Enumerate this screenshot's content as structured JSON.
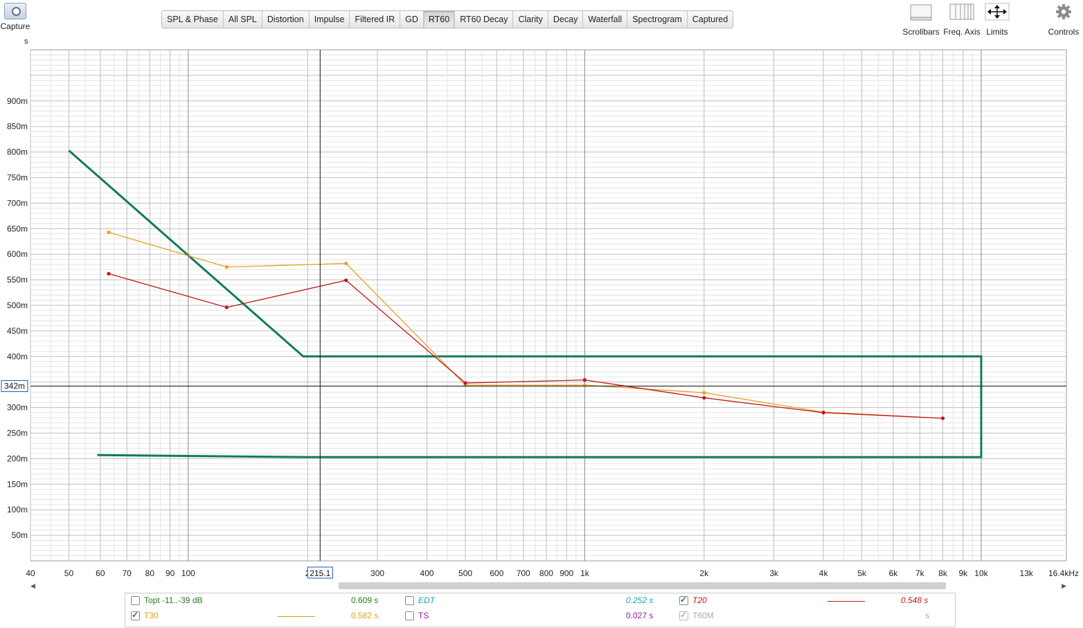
{
  "toolbar": {
    "capture_label": "Capture",
    "tabs": [
      "SPL & Phase",
      "All SPL",
      "Distortion",
      "Impulse",
      "Filtered IR",
      "GD",
      "RT60",
      "RT60 Decay",
      "Clarity",
      "Decay",
      "Waterfall",
      "Spectrogram",
      "Captured"
    ],
    "active_tab": "RT60",
    "scrollbars_label": "Scrollbars",
    "freq_axis_label": "Freq. Axis",
    "limits_label": "Limits",
    "controls_label": "Controls"
  },
  "colors": {
    "t30": "#e8a020",
    "t20": "#c01818",
    "target": "#117a58",
    "grid_major": "#bdbdbd",
    "grid_minor": "#e4e4e4",
    "cursor_box": "#1c4fc0"
  },
  "chart_data": {
    "type": "line",
    "xscale": "log",
    "xlim": [
      40,
      16400
    ],
    "ylim": [
      0,
      1
    ],
    "y_unit": "s",
    "x_ticks": [
      {
        "v": 40,
        "t": "40"
      },
      {
        "v": 50,
        "t": "50"
      },
      {
        "v": 60,
        "t": "60"
      },
      {
        "v": 70,
        "t": "70"
      },
      {
        "v": 80,
        "t": "80"
      },
      {
        "v": 90,
        "t": "90"
      },
      {
        "v": 100,
        "t": "100"
      },
      {
        "v": 200,
        "t": "2"
      },
      {
        "v": 300,
        "t": "300"
      },
      {
        "v": 400,
        "t": "400"
      },
      {
        "v": 500,
        "t": "500"
      },
      {
        "v": 600,
        "t": "600"
      },
      {
        "v": 700,
        "t": "700"
      },
      {
        "v": 800,
        "t": "800"
      },
      {
        "v": 900,
        "t": "900"
      },
      {
        "v": 1000,
        "t": "1k"
      },
      {
        "v": 2000,
        "t": "2k"
      },
      {
        "v": 3000,
        "t": "3k"
      },
      {
        "v": 4000,
        "t": "4k"
      },
      {
        "v": 5000,
        "t": "5k"
      },
      {
        "v": 6000,
        "t": "6k"
      },
      {
        "v": 7000,
        "t": "7k"
      },
      {
        "v": 8000,
        "t": "8k"
      },
      {
        "v": 9000,
        "t": "9k"
      },
      {
        "v": 10000,
        "t": "10k"
      },
      {
        "v": 13000,
        "t": "13k"
      },
      {
        "v": 16400,
        "t": "16.4kHz"
      }
    ],
    "y_ticks": [
      {
        "v": 0.05,
        "t": "50m"
      },
      {
        "v": 0.1,
        "t": "100m"
      },
      {
        "v": 0.15,
        "t": "150m"
      },
      {
        "v": 0.2,
        "t": "200m"
      },
      {
        "v": 0.25,
        "t": "250m"
      },
      {
        "v": 0.3,
        "t": "300m"
      },
      {
        "v": 0.4,
        "t": "400m"
      },
      {
        "v": 0.45,
        "t": "450m"
      },
      {
        "v": 0.5,
        "t": "500m"
      },
      {
        "v": 0.55,
        "t": "550m"
      },
      {
        "v": 0.6,
        "t": "600m"
      },
      {
        "v": 0.65,
        "t": "650m"
      },
      {
        "v": 0.7,
        "t": "700m"
      },
      {
        "v": 0.75,
        "t": "750m"
      },
      {
        "v": 0.8,
        "t": "800m"
      },
      {
        "v": 0.85,
        "t": "850m"
      },
      {
        "v": 0.9,
        "t": "900m"
      }
    ],
    "series": [
      {
        "name": "T30",
        "color": "#e8a020",
        "x": [
          63,
          125,
          250,
          500,
          1000,
          2000,
          4000,
          8000
        ],
        "y": [
          0.643,
          0.575,
          0.582,
          0.344,
          0.344,
          0.329,
          0.291,
          0.279
        ]
      },
      {
        "name": "T20",
        "color": "#c01818",
        "x": [
          63,
          125,
          250,
          500,
          1000,
          2000,
          4000,
          8000
        ],
        "y": [
          0.562,
          0.496,
          0.549,
          0.348,
          0.354,
          0.319,
          0.29,
          0.279
        ]
      }
    ],
    "target_lines": [
      {
        "x": [
          50,
          195,
          195,
          10000,
          10000,
          195
        ],
        "y": [
          0.803,
          0.4,
          0.4,
          0.4,
          0.203,
          0.203
        ]
      },
      {
        "x": [
          59,
          195
        ],
        "y": [
          0.207,
          0.203
        ]
      }
    ],
    "cursor": {
      "x": 215.1,
      "y": 0.342,
      "x_label": "215.1",
      "y_label": "342m"
    }
  },
  "legend": {
    "row1": {
      "topt": {
        "label": "Topt -11..-39 dB",
        "value": "0.609 s",
        "checked": false
      },
      "edt": {
        "label": "EDT",
        "value": "0.252 s",
        "checked": false
      },
      "t20": {
        "label": "T20",
        "value": "0.548 s",
        "checked": true
      }
    },
    "row2": {
      "t30": {
        "label": "T30",
        "value": "0.582 s",
        "checked": true
      },
      "ts": {
        "label": "TS",
        "value": "0.027 s",
        "checked": false
      },
      "t60m": {
        "label": "T60M",
        "value": "s",
        "checked": true
      }
    }
  },
  "axis": {
    "y_unit": "s"
  }
}
